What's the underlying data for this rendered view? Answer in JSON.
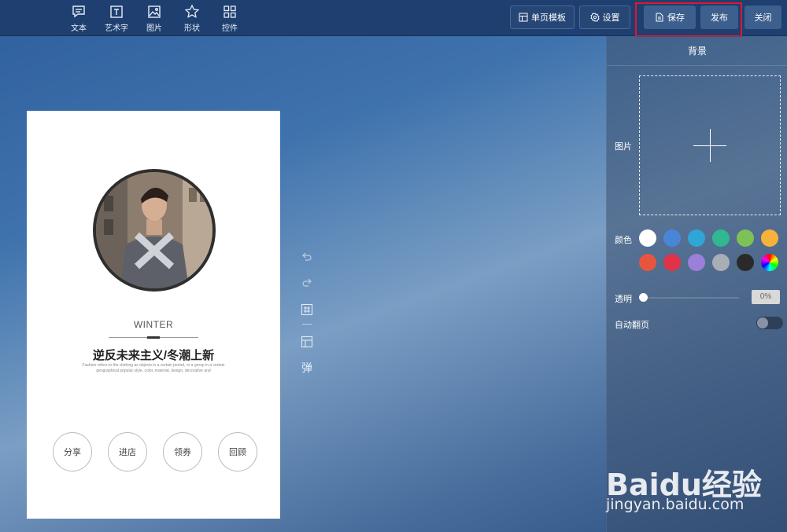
{
  "toolbar": {
    "tools": [
      {
        "label": "文本",
        "icon": "text-comment-icon"
      },
      {
        "label": "艺术字",
        "icon": "art-text-icon"
      },
      {
        "label": "图片",
        "icon": "image-icon"
      },
      {
        "label": "形状",
        "icon": "star-shape-icon"
      },
      {
        "label": "控件",
        "icon": "widget-grid-icon"
      }
    ],
    "template_label": "单页模板",
    "settings_label": "设置",
    "save_label": "保存",
    "publish_label": "发布",
    "close_label": "关闭"
  },
  "panel": {
    "title": "背景",
    "image_label": "图片",
    "color_label": "颜色",
    "colors": [
      "#ffffff",
      "#4a86d8",
      "#2fa6d6",
      "#31b890",
      "#7ec157",
      "#f7b23b",
      "#e8553e",
      "#e0334a",
      "#9b7fd9",
      "#a9adb5",
      "#2a2a2a",
      "rainbow"
    ],
    "opacity_label": "透明",
    "opacity_value": "0%",
    "opacity_level": 0,
    "autoflip_label": "自动翻页",
    "autoflip_on": false
  },
  "side": {
    "popup_label": "弹"
  },
  "preview": {
    "subtitle": "WINTER",
    "headline": "逆反未来主义/冬潮上新",
    "description": "Fashion refers to the clothing as objects in a certain period, or a group in a certain geographical popular style, color, material, design, decorative and",
    "buttons": [
      "分享",
      "进店",
      "领券",
      "回顾"
    ]
  },
  "watermark": {
    "main": "Baidu经验",
    "sub": "jingyan.baidu.com"
  }
}
